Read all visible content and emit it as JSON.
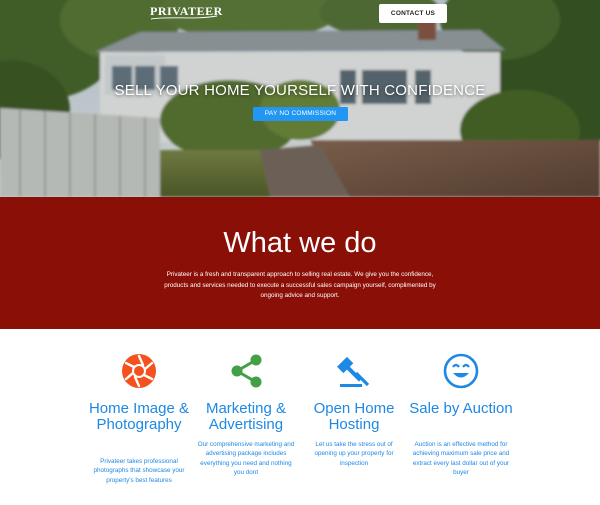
{
  "header": {
    "logo": "PRIVATEER",
    "contact_label": "CONTACT US"
  },
  "hero": {
    "headline": "SELL YOUR HOME YOURSELF WITH CONFIDENCE",
    "cta_label": "PAY NO COMMISSION"
  },
  "what_we_do": {
    "title": "What we do",
    "text": "Privateer is a fresh and transparent approach to selling real estate. We give you the confidence, products and services needed to execute a successful sales campaign yourself, complimented by ongoing advice and support."
  },
  "services": [
    {
      "icon": "camera-aperture-icon",
      "title": "Home Image & Photography",
      "desc": "Privateer takes professional photographs that showcase your property's best features",
      "icon_color": "#f4511e"
    },
    {
      "icon": "share-icon",
      "title": "Marketing & Advertising",
      "desc": "Our comprehensive marketing and advertising package includes everything you need and nothing you dont",
      "icon_color": "#43a047"
    },
    {
      "icon": "gavel-icon",
      "title": "Open Home Hosting",
      "desc": "Let us take the stress out of opening up your property for inspection",
      "icon_color": "#1e88e5"
    },
    {
      "icon": "smiley-icon",
      "title": "Sale by Auction",
      "desc": "Auction is an effective method for achieving maximum sale price and extract every last dollar out of your buyer",
      "icon_color": "#1e88e5"
    }
  ],
  "colors": {
    "primary_red": "#8a0f07",
    "accent_blue": "#2196f3",
    "text_blue": "#1e88e5"
  }
}
